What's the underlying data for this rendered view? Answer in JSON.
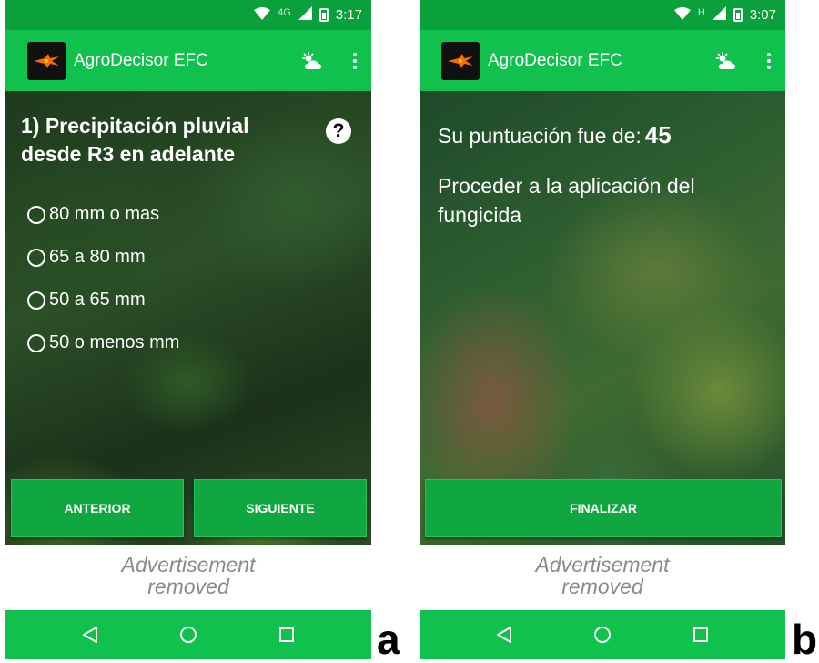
{
  "panels": {
    "a": {
      "status": {
        "network": "4G",
        "time": "3:17"
      },
      "app_bar": {
        "title": "AgroDecisor EFC"
      },
      "question": "1) Precipitación pluvial desde R3 en adelante",
      "help_glyph": "?",
      "options": [
        "80 mm o mas",
        "65 a 80 mm",
        "50 a 65 mm",
        "50 o menos mm"
      ],
      "buttons": {
        "previous": "ANTERIOR",
        "next": "SIGUIENTE"
      },
      "ad_line1": "Advertisement",
      "ad_line2": "removed",
      "label": "a"
    },
    "b": {
      "status": {
        "network": "H",
        "time": "3:07"
      },
      "app_bar": {
        "title": "AgroDecisor EFC"
      },
      "score_label": "Su puntuación fue de:",
      "score_value": "45",
      "result": "Proceder a la aplicación del fungicida",
      "buttons": {
        "finish": "FINALIZAR"
      },
      "ad_line1": "Advertisement",
      "ad_line2": "removed",
      "label": "b"
    }
  },
  "icons": {
    "wifi": "wifi-icon",
    "signal": "cell-signal-icon",
    "battery": "battery-icon",
    "logo": "logo-icon",
    "weather": "weather-partly-cloudy-icon",
    "menu": "overflow-menu-icon",
    "help": "help-icon",
    "back": "back-icon",
    "home": "home-icon",
    "recents": "recents-icon"
  },
  "colors": {
    "status_bar": "#0aa03c",
    "app_bar": "#10c14d",
    "button": "#10a741",
    "nav_bar": "#10c14d",
    "ad_text": "#8a8a8a"
  }
}
